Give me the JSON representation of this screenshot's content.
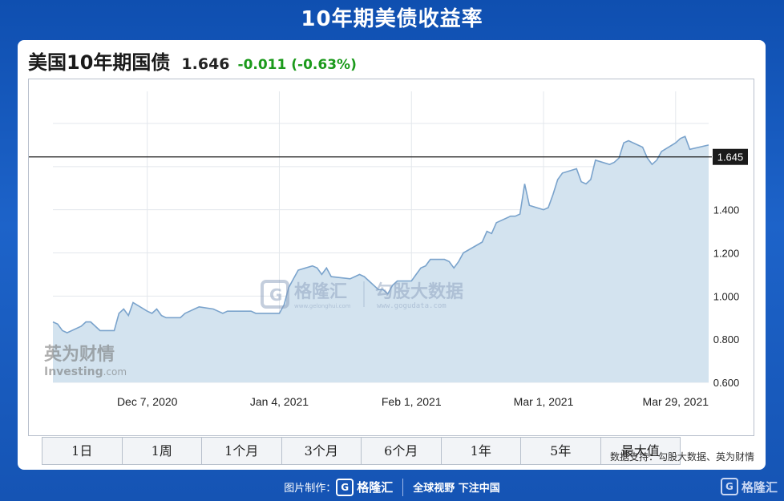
{
  "banner_title": "10年期美债收益率",
  "header": {
    "title": "美国10年期国债",
    "price": "1.646",
    "change": "-0.011 (-0.63%)"
  },
  "chart_data": {
    "type": "area",
    "x": [
      "2020-11-17",
      "2020-11-18",
      "2020-11-19",
      "2020-11-20",
      "2020-11-23",
      "2020-11-24",
      "2020-11-25",
      "2020-11-27",
      "2020-11-30",
      "2020-12-01",
      "2020-12-02",
      "2020-12-03",
      "2020-12-04",
      "2020-12-07",
      "2020-12-08",
      "2020-12-09",
      "2020-12-10",
      "2020-12-11",
      "2020-12-14",
      "2020-12-15",
      "2020-12-16",
      "2020-12-17",
      "2020-12-18",
      "2020-12-21",
      "2020-12-22",
      "2020-12-23",
      "2020-12-24",
      "2020-12-28",
      "2020-12-29",
      "2020-12-30",
      "2020-12-31",
      "2021-01-04",
      "2021-01-05",
      "2021-01-06",
      "2021-01-07",
      "2021-01-08",
      "2021-01-11",
      "2021-01-12",
      "2021-01-13",
      "2021-01-14",
      "2021-01-15",
      "2021-01-19",
      "2021-01-20",
      "2021-01-21",
      "2021-01-22",
      "2021-01-25",
      "2021-01-26",
      "2021-01-27",
      "2021-01-28",
      "2021-01-29",
      "2021-02-01",
      "2021-02-02",
      "2021-02-03",
      "2021-02-04",
      "2021-02-05",
      "2021-02-08",
      "2021-02-09",
      "2021-02-10",
      "2021-02-11",
      "2021-02-12",
      "2021-02-16",
      "2021-02-17",
      "2021-02-18",
      "2021-02-19",
      "2021-02-22",
      "2021-02-23",
      "2021-02-24",
      "2021-02-25",
      "2021-02-26",
      "2021-03-01",
      "2021-03-02",
      "2021-03-03",
      "2021-03-04",
      "2021-03-05",
      "2021-03-08",
      "2021-03-09",
      "2021-03-10",
      "2021-03-11",
      "2021-03-12",
      "2021-03-15",
      "2021-03-16",
      "2021-03-17",
      "2021-03-18",
      "2021-03-19",
      "2021-03-22",
      "2021-03-23",
      "2021-03-24",
      "2021-03-25",
      "2021-03-26",
      "2021-03-29",
      "2021-03-30",
      "2021-03-31",
      "2021-04-01",
      "2021-04-05"
    ],
    "y": [
      0.88,
      0.87,
      0.84,
      0.83,
      0.86,
      0.88,
      0.88,
      0.84,
      0.84,
      0.92,
      0.94,
      0.91,
      0.97,
      0.93,
      0.92,
      0.94,
      0.91,
      0.9,
      0.9,
      0.92,
      0.93,
      0.94,
      0.95,
      0.94,
      0.93,
      0.92,
      0.93,
      0.93,
      0.93,
      0.92,
      0.92,
      0.92,
      0.96,
      1.04,
      1.08,
      1.12,
      1.14,
      1.13,
      1.1,
      1.13,
      1.09,
      1.08,
      1.09,
      1.1,
      1.09,
      1.03,
      1.03,
      1.01,
      1.05,
      1.07,
      1.07,
      1.1,
      1.13,
      1.14,
      1.17,
      1.17,
      1.16,
      1.13,
      1.16,
      1.2,
      1.25,
      1.3,
      1.29,
      1.34,
      1.37,
      1.37,
      1.38,
      1.52,
      1.42,
      1.4,
      1.41,
      1.47,
      1.54,
      1.57,
      1.59,
      1.53,
      1.52,
      1.54,
      1.63,
      1.61,
      1.62,
      1.64,
      1.71,
      1.72,
      1.69,
      1.64,
      1.61,
      1.63,
      1.67,
      1.71,
      1.73,
      1.74,
      1.68,
      1.7,
      1.65
    ],
    "last_value_label": "1.645",
    "reference_line": 1.645,
    "ylim": [
      0.6,
      1.8
    ],
    "y_ticks": [
      "0.600",
      "0.800",
      "1.000",
      "1.200",
      "1.400"
    ],
    "x_tick_labels": [
      {
        "label": "Dec 7, 2020",
        "x": "2020-12-07"
      },
      {
        "label": "Jan 4, 2021",
        "x": "2021-01-04"
      },
      {
        "label": "Feb 1, 2021",
        "x": "2021-02-01"
      },
      {
        "label": "Mar 1, 2021",
        "x": "2021-03-01"
      },
      {
        "label": "Mar 29, 2021",
        "x": "2021-03-29"
      }
    ],
    "grid": true,
    "colors": {
      "line": "#7aa3cc",
      "fill": "#d3e3ef",
      "reference": "#1a1a1a",
      "label_bg": "#1a1a1a"
    }
  },
  "ranges": [
    "1日",
    "1周",
    "1个月",
    "3个月",
    "6个月",
    "1年",
    "5年",
    "最大值"
  ],
  "watermarks": {
    "ggh": "格隆汇",
    "ggh_url": "www.gelonghui.com",
    "gogu": "勾股大数据",
    "gogu_url": "www.gogudata.com",
    "ying": "英为财情",
    "investing": "Investing",
    "investing_suffix": ".com"
  },
  "source": "数据支持：勾股大数据、英为财情",
  "footer": {
    "made_by": "图片制作：",
    "brand": "格隆汇",
    "slogan": "全球视野 下注中国",
    "corner_brand": "格隆汇"
  }
}
